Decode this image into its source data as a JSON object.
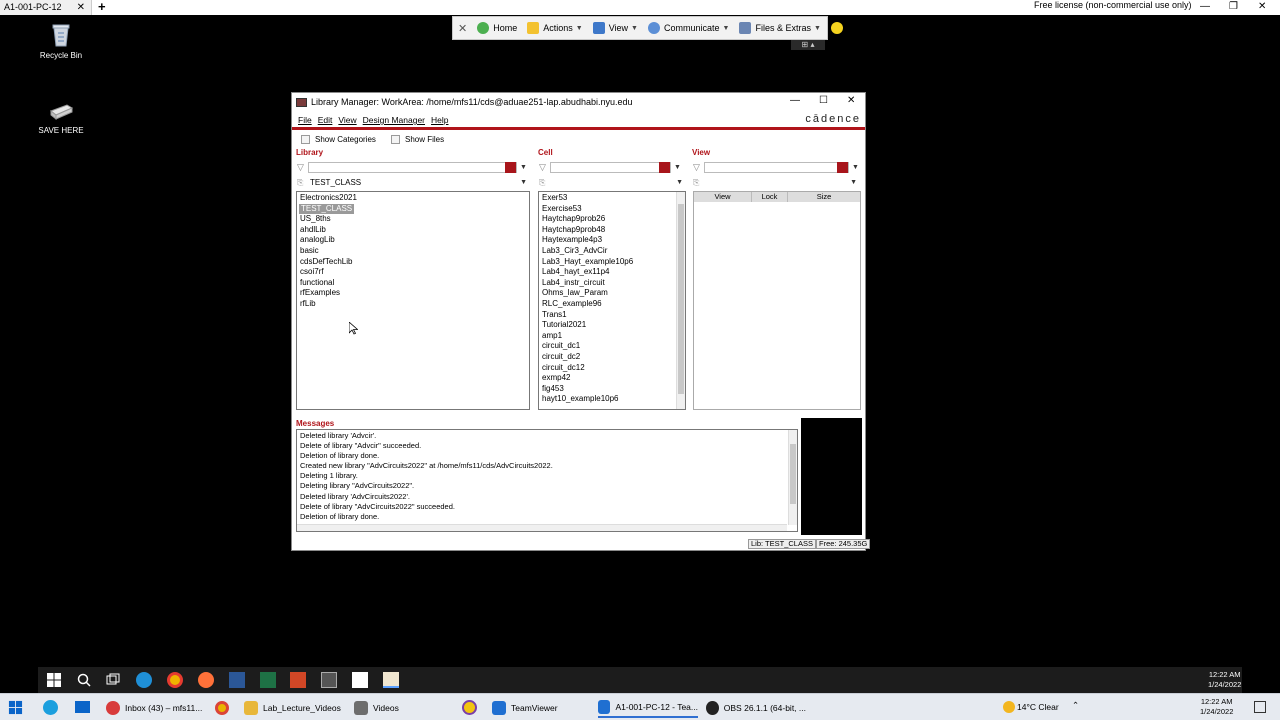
{
  "host": {
    "tab_title": "A1-001-PC-12",
    "tab_close": "✕",
    "new_tab": "+",
    "license_text": "Free license (non-commercial use only)",
    "minimize": "—",
    "restore": "❐",
    "close": "✕"
  },
  "desktop": {
    "icons": [
      {
        "label": "Recycle Bin"
      },
      {
        "label": "SAVE HERE"
      }
    ]
  },
  "teamviewer_toolbar": {
    "close_glyph": "✕",
    "items": [
      {
        "label": "Home"
      },
      {
        "label": "Actions"
      },
      {
        "label": "View"
      },
      {
        "label": "Communicate"
      },
      {
        "label": "Files & Extras"
      }
    ],
    "mini_controls": "⊞ ▴"
  },
  "library_manager": {
    "title": "Library Manager: WorkArea: /home/mfs11/cds@aduae251-lap.abudhabi.nyu.edu",
    "brand": "cādence",
    "window_controls": {
      "minimize": "—",
      "maximize": "☐",
      "close": "✕"
    },
    "menu": [
      "File",
      "Edit",
      "View",
      "Design Manager",
      "Help"
    ],
    "options": {
      "show_categories": "Show Categories",
      "show_files": "Show Files"
    },
    "library": {
      "label": "Library",
      "selected": "TEST_CLASS",
      "items": [
        "Electronics2021",
        "TEST_CLASS",
        "US_8ths",
        "ahdlLib",
        "analogLib",
        "basic",
        "cdsDefTechLib",
        "csoi7rf",
        "functional",
        "rfExamples",
        "rfLib"
      ],
      "selected_index": 1
    },
    "cell": {
      "label": "Cell",
      "items": [
        "Exer53",
        "Exercise53",
        "Haytchap9prob26",
        "Haytchap9prob48",
        "Haytexample4p3",
        "Lab3_Cir3_AdvCir",
        "Lab3_Hayt_example10p6",
        "Lab4_hayt_ex11p4",
        "Lab4_instr_circuit",
        "Ohms_law_Param",
        "RLC_example96",
        "Trans1",
        "Tutorial2021",
        "amp1",
        "circuit_dc1",
        "circuit_dc2",
        "circuit_dc12",
        "exmp42",
        "fig453",
        "hayt10_example10p6"
      ]
    },
    "view": {
      "label": "View",
      "columns": [
        "View",
        "Lock",
        "Size"
      ]
    },
    "messages": {
      "label": "Messages",
      "lines": [
        "Deleted library 'Advcir'.",
        "Delete of library \"Advcir\" succeeded.",
        "Deletion of library done.",
        "Created new library \"AdvCircuits2022\" at /home/mfs11/cds/AdvCircuits2022.",
        "Deleting 1 library.",
        "Deleting library \"AdvCircuits2022\".",
        "Deleted library 'AdvCircuits2022'.",
        "Delete of library \"AdvCircuits2022\" succeeded.",
        "Deletion of library done."
      ]
    },
    "status": {
      "lib": "Lib: TEST_CLASS",
      "free": "Free: 245.35G"
    }
  },
  "remote_taskbar": {
    "time": "12:22 AM",
    "date": "1/24/2022"
  },
  "host_taskbar": {
    "apps": [
      {
        "label": "Inbox (43) – mfs11...",
        "color": "#d83b3b"
      },
      {
        "label": "Lab_Lecture_Videos",
        "color": "#e8b73a"
      },
      {
        "label": "Videos",
        "color": "#6d6d6d"
      },
      {
        "label": "TeamViewer",
        "color": "#1f6fd1"
      },
      {
        "label": "A1-001-PC-12 - Tea...",
        "color": "#1f6fd1"
      },
      {
        "label": "OBS 26.1.1 (64-bit, ...",
        "color": "#222222"
      }
    ],
    "weather": "14°C  Clear",
    "time": "12:22 AM",
    "date": "1/24/2022"
  },
  "colors": {
    "cadence_red": "#b0141a",
    "taskbar_dark": "#1c1c1c",
    "host_taskbar": "#e6eaf0"
  }
}
